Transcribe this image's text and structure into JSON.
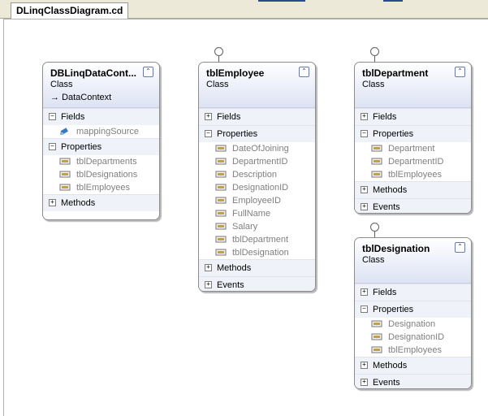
{
  "tab": {
    "title": "DLinqClassDiagram.cd"
  },
  "shapes": [
    {
      "name": "DBLinqDataCont...",
      "kind": "Class",
      "base": "DataContext",
      "sections": [
        {
          "label": "Fields",
          "expanded": true,
          "members": [
            "mappingSource"
          ],
          "icon": "field"
        },
        {
          "label": "Properties",
          "expanded": true,
          "members": [
            "tblDepartments",
            "tblDesignations",
            "tblEmployees"
          ],
          "icon": "property"
        },
        {
          "label": "Methods",
          "expanded": false,
          "members": []
        }
      ]
    },
    {
      "name": "tblEmployee",
      "kind": "Class",
      "sections": [
        {
          "label": "Fields",
          "expanded": false,
          "members": []
        },
        {
          "label": "Properties",
          "expanded": true,
          "members": [
            "DateOfJoining",
            "DepartmentID",
            "Description",
            "DesignationID",
            "EmployeeID",
            "FullName",
            "Salary",
            "tblDepartment",
            "tblDesignation"
          ],
          "icon": "property"
        },
        {
          "label": "Methods",
          "expanded": false,
          "members": []
        },
        {
          "label": "Events",
          "expanded": false,
          "members": []
        }
      ]
    },
    {
      "name": "tblDepartment",
      "kind": "Class",
      "sections": [
        {
          "label": "Fields",
          "expanded": false,
          "members": []
        },
        {
          "label": "Properties",
          "expanded": true,
          "members": [
            "Department",
            "DepartmentID",
            "tblEmployees"
          ],
          "icon": "property"
        },
        {
          "label": "Methods",
          "expanded": false,
          "members": []
        },
        {
          "label": "Events",
          "expanded": false,
          "members": []
        }
      ]
    },
    {
      "name": "tblDesignation",
      "kind": "Class",
      "sections": [
        {
          "label": "Fields",
          "expanded": false,
          "members": []
        },
        {
          "label": "Properties",
          "expanded": true,
          "members": [
            "Designation",
            "DesignationID",
            "tblEmployees"
          ],
          "icon": "property"
        },
        {
          "label": "Methods",
          "expanded": false,
          "members": []
        },
        {
          "label": "Events",
          "expanded": false,
          "members": []
        }
      ]
    }
  ],
  "colors": {
    "header_gradient_end": "#dde3f3",
    "member_text": "#7f7f7f",
    "section_bg": "#eff2f8"
  }
}
